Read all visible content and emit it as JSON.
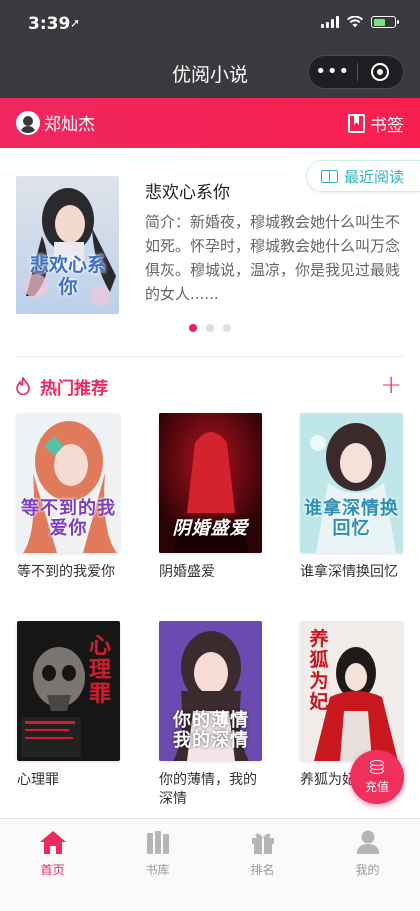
{
  "status": {
    "time": "3:39",
    "location_glyph": "➚"
  },
  "nav": {
    "title": "优阅小说",
    "more": "•••"
  },
  "header": {
    "username": "郑灿杰",
    "bookmark_label": "书签"
  },
  "featured": {
    "recent_label": "最近阅读",
    "book_title": "悲欢心系你",
    "description": "简介：新婚夜，穆城教会她什么叫生不如死。怀孕时，穆城教会她什么叫万念俱灰。穆城说，温凉，你是我见过最贱的女人......",
    "cover_text": "悲欢心系你",
    "carousel_active_index": 0,
    "carousel_count": 3
  },
  "hot": {
    "title": "热门推荐",
    "more": "+",
    "books": [
      {
        "name": "等不到的我爱你",
        "cover_text": "等不到的我爱你"
      },
      {
        "name": "阴婚盛爱",
        "cover_text": "阴婚盛爱"
      },
      {
        "name": "谁拿深情换回忆",
        "cover_text": "谁拿深情换回忆"
      },
      {
        "name": "心理罪",
        "cover_text": "心理罪"
      },
      {
        "name": "你的薄情，我的深情",
        "cover_text": "你的薄情我的深情"
      },
      {
        "name": "养狐为妃",
        "cover_text": "养狐为妃"
      }
    ]
  },
  "recharge": {
    "label": "充值"
  },
  "tabs": [
    {
      "label": "首页",
      "icon": "home-icon",
      "active": true
    },
    {
      "label": "书库",
      "icon": "library-icon",
      "active": false
    },
    {
      "label": "排名",
      "icon": "gift-icon",
      "active": false
    },
    {
      "label": "我的",
      "icon": "profile-icon",
      "active": false
    }
  ],
  "colors": {
    "accent": "#ee2a5c",
    "teal": "#34b3c1",
    "dark": "#3a393e"
  }
}
